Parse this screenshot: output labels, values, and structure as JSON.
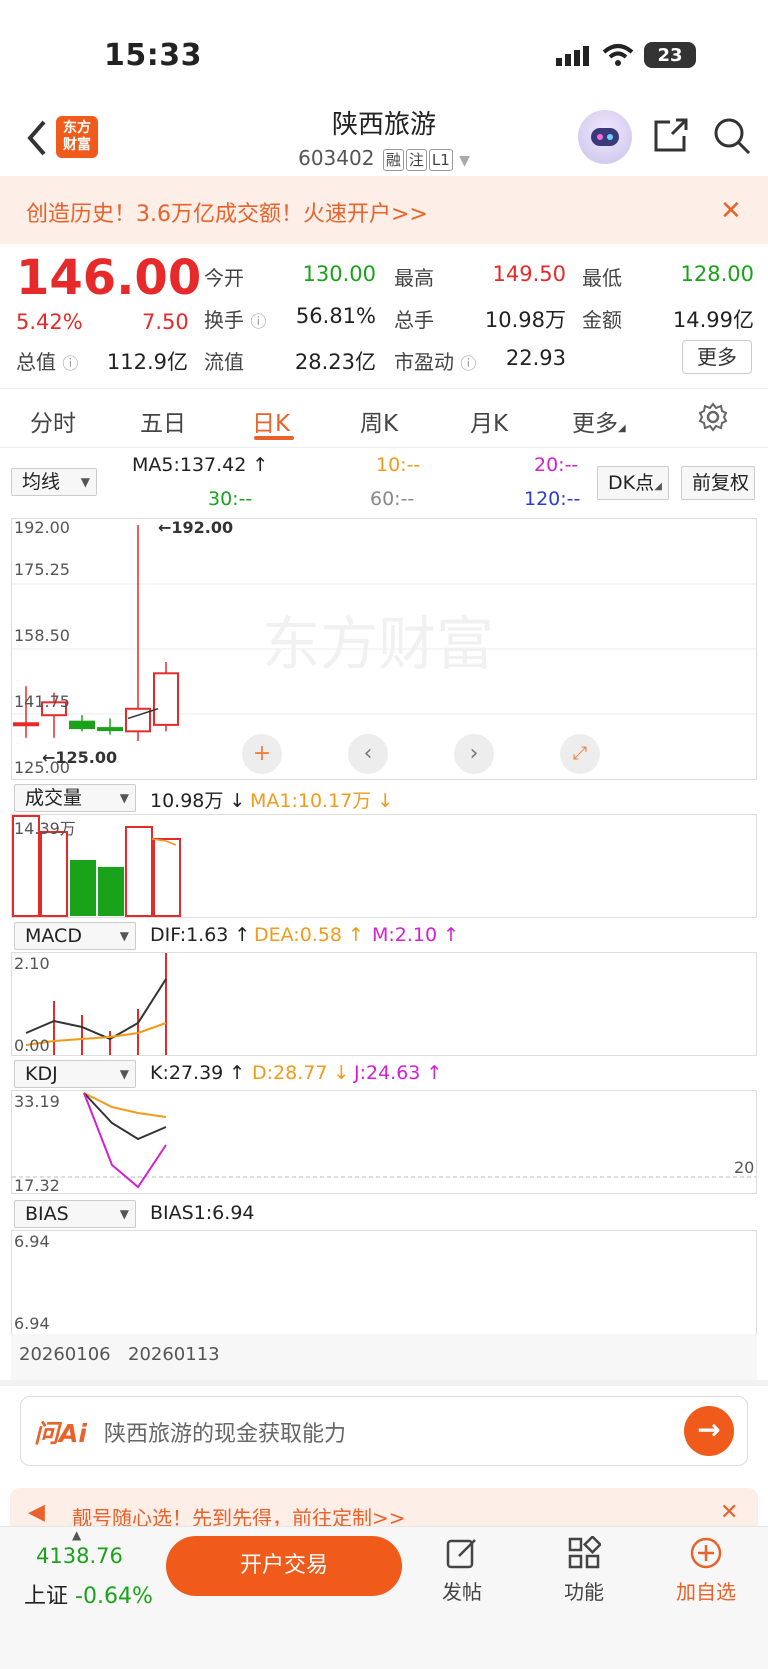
{
  "status": {
    "time": "15:33",
    "battery": "23"
  },
  "header": {
    "logo_text": "东方财富",
    "name": "陕西旅游",
    "code": "603402",
    "tags": [
      "融",
      "注",
      "L1"
    ]
  },
  "promo": {
    "text": "创造历史！3.6万亿成交额！火速开户>>"
  },
  "quote": {
    "price": "146.00",
    "pct": "5.42%",
    "chg": "7.50",
    "rows": [
      [
        {
          "l": "今开",
          "v": "130.00",
          "c": "green"
        },
        {
          "l": "最高",
          "v": "149.50",
          "c": "red"
        },
        {
          "l": "最低",
          "v": "128.00",
          "c": "green"
        }
      ],
      [
        {
          "l": "换手",
          "v": "56.81%",
          "c": "black"
        },
        {
          "l": "总手",
          "v": "10.98万",
          "c": "black"
        },
        {
          "l": "金额",
          "v": "14.99亿",
          "c": "black"
        }
      ],
      [
        {
          "l": "总值",
          "v": "112.9亿",
          "c": "black"
        },
        {
          "l": "流值",
          "v": "28.23亿",
          "c": "black"
        },
        {
          "l": "市盈动",
          "v": "22.93",
          "c": "black"
        }
      ]
    ],
    "more": "更多"
  },
  "tabs": [
    "分时",
    "五日",
    "日K",
    "周K",
    "月K",
    "更多"
  ],
  "ma": {
    "selector": "均线",
    "ma5": "MA5:137.42 ↑",
    "ma10": "10:--",
    "ma20": "20:--",
    "ma30": "30:--",
    "ma60": "60:--",
    "ma120": "120:--",
    "dk": "DK点",
    "fq": "前复权"
  },
  "kline": {
    "y_labels": [
      "192.00",
      "175.25",
      "158.50",
      "141.75",
      "125.00"
    ],
    "max_label": "←192.00",
    "min_label": "←125.00",
    "watermark": "东方财富"
  },
  "chart_data": [
    {
      "type": "candlestick",
      "ylim": [
        125,
        192
      ],
      "candles": [
        {
          "open": 130,
          "close": 130.5,
          "high": 142,
          "low": 126
        },
        {
          "open": 133,
          "close": 137,
          "high": 140,
          "low": 126
        },
        {
          "open": 131,
          "close": 129,
          "high": 133,
          "low": 128
        },
        {
          "open": 129,
          "close": 128.5,
          "high": 132,
          "low": 127
        },
        {
          "open": 128,
          "close": 135,
          "high": 192,
          "low": 125
        },
        {
          "open": 130,
          "close": 146,
          "high": 149.5,
          "low": 128
        }
      ]
    }
  ],
  "volume": {
    "selector": "成交量",
    "value": "10.98万 ↓",
    "ma1": "MA1:10.17万 ↓",
    "top_label": "14.39万"
  },
  "macd": {
    "selector": "MACD",
    "dif": "DIF:1.63 ↑",
    "dea": "DEA:0.58 ↑",
    "m": "M:2.10 ↑",
    "top_label": "2.10",
    "bottom_label": "0.00"
  },
  "kdj": {
    "selector": "KDJ",
    "k": "K:27.39 ↑",
    "d": "D:28.77 ↓",
    "j": "J:24.63 ↑",
    "top_label": "33.19",
    "bottom_label": "17.32",
    "ref_label": "20"
  },
  "bias": {
    "selector": "BIAS",
    "bias1": "BIAS1:6.94",
    "top_label": "6.94",
    "bottom_label": "6.94"
  },
  "dates": [
    "20260106",
    "20260113"
  ],
  "ai": {
    "logo": "问Ai",
    "text": "陕西旅游的现金获取能力"
  },
  "ad": {
    "text": "靓号随心选！先到先得，前往定制>>"
  },
  "bottom": {
    "index_value": "4138.76",
    "index_name": "上证",
    "index_pct": "-0.64%",
    "open_account": "开户交易",
    "items": [
      "发帖",
      "功能",
      "加自选"
    ]
  }
}
